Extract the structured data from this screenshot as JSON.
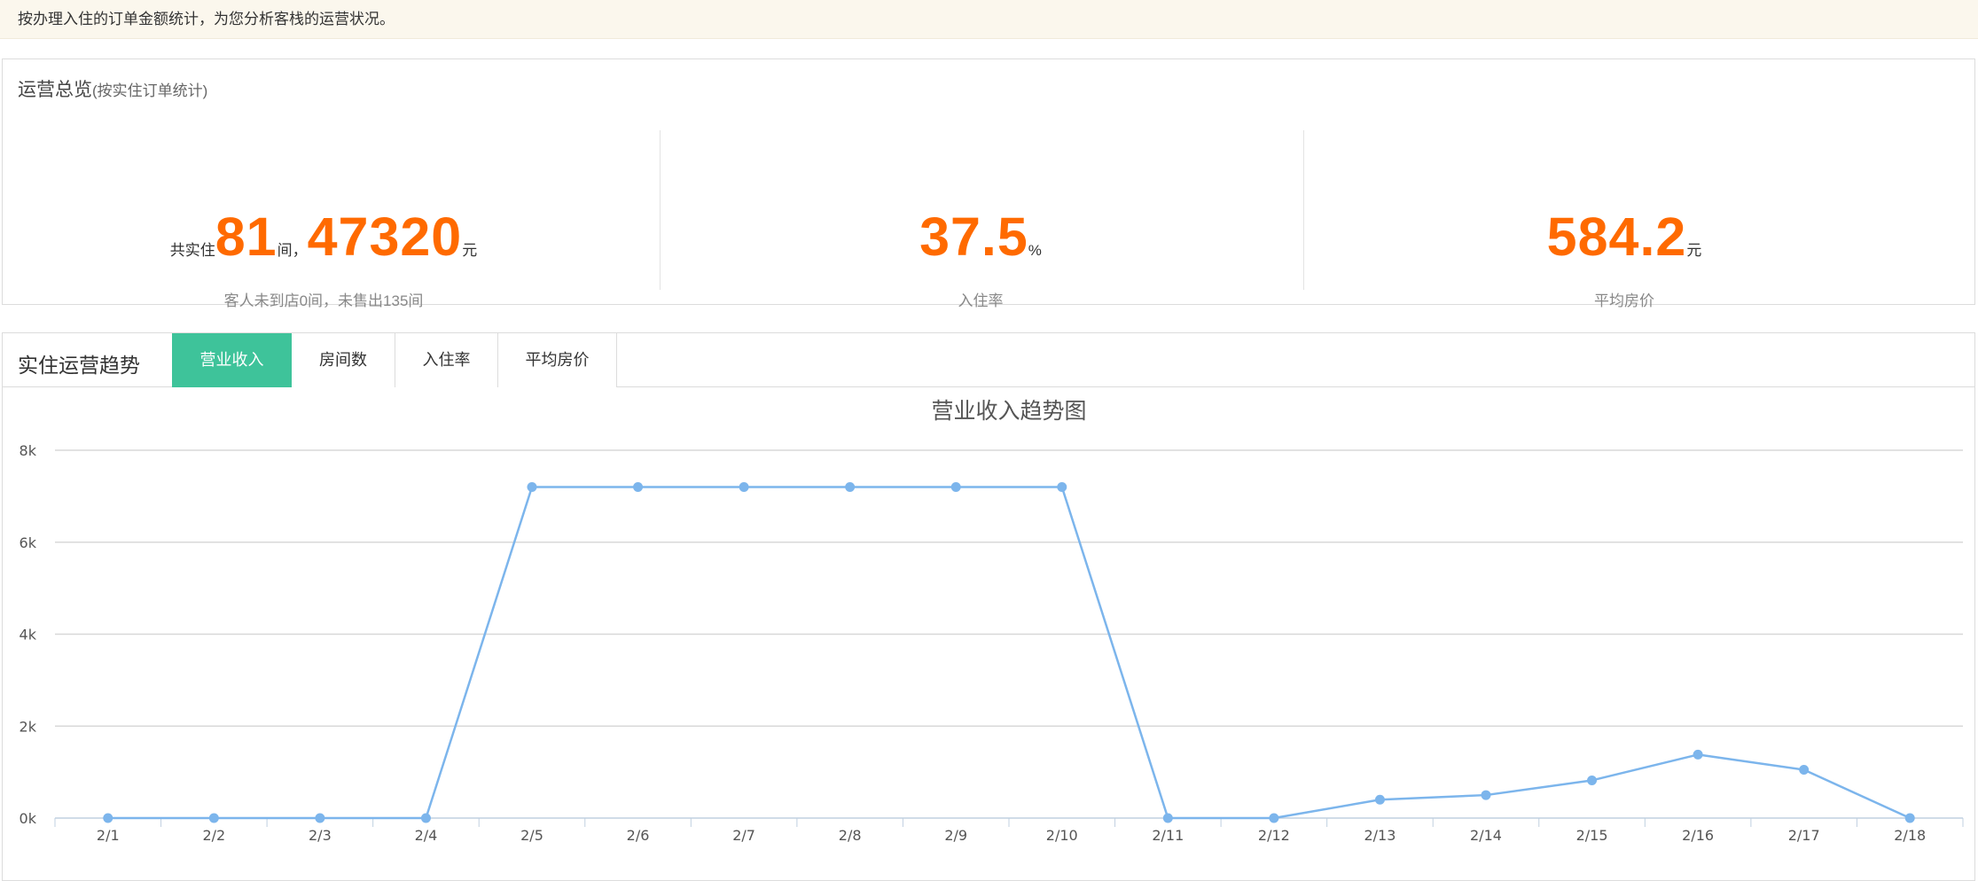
{
  "notice": {
    "text": "按办理入住的订单金额统计，为您分析客栈的运营状况。"
  },
  "overview": {
    "title": "运营总览",
    "subtitle": "(按实住订单统计)",
    "stats": [
      {
        "prefix": "共实住",
        "rooms": "81",
        "rooms_unit": "间，",
        "amount": "47320",
        "amount_unit": "元",
        "caption": "客人未到店0间，未售出135间"
      },
      {
        "value": "37.5",
        "unit": "%",
        "caption": "入住率"
      },
      {
        "value": "584.2",
        "unit": "元",
        "caption": "平均房价"
      }
    ]
  },
  "trend": {
    "title": "实住运营趋势",
    "tabs": [
      {
        "label": "营业收入",
        "active": true
      },
      {
        "label": "房间数",
        "active": false
      },
      {
        "label": "入住率",
        "active": false
      },
      {
        "label": "平均房价",
        "active": false
      }
    ]
  },
  "colors": {
    "accent_orange": "#ff6a00",
    "tab_active": "#3ec39a",
    "line": "#7cb5ec",
    "notice_bg": "#fbf7ed"
  },
  "chart_data": {
    "type": "line",
    "title": "营业收入趋势图",
    "categories": [
      "2/1",
      "2/2",
      "2/3",
      "2/4",
      "2/5",
      "2/6",
      "2/7",
      "2/8",
      "2/9",
      "2/10",
      "2/11",
      "2/12",
      "2/13",
      "2/14",
      "2/15",
      "2/16",
      "2/17",
      "2/18"
    ],
    "series": [
      {
        "values": [
          0,
          0,
          0,
          0,
          7200,
          7200,
          7200,
          7200,
          7200,
          7200,
          0,
          0,
          400,
          500,
          820,
          1380,
          1050,
          0
        ]
      }
    ],
    "yticks": [
      "0k",
      "2k",
      "4k",
      "6k",
      "8k"
    ],
    "ylim": [
      0,
      8000
    ],
    "grid": true,
    "legend": "none"
  }
}
